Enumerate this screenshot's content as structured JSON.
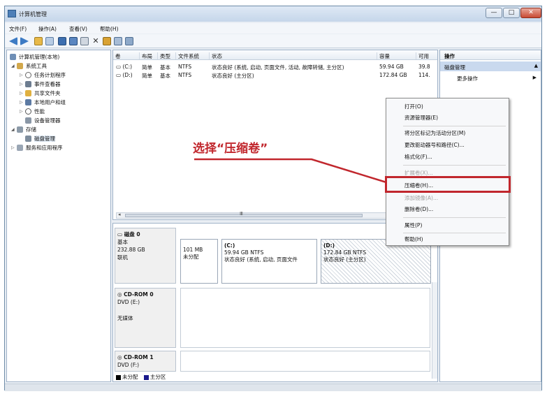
{
  "window": {
    "title": "计算机管理",
    "buttons": {
      "minimize": "—",
      "maximize": "□",
      "close": "✕"
    }
  },
  "menu": [
    "文件(F)",
    "操作(A)",
    "查看(V)",
    "帮助(H)"
  ],
  "toolbar": {
    "icons": [
      "back-icon",
      "forward-icon",
      "up-folder-icon",
      "console-tree-icon",
      "properties-icon",
      "help-icon",
      "delete-icon",
      "check-icon",
      "open-folder-icon",
      "search-icon",
      "zoom-icon"
    ]
  },
  "tree": {
    "items": [
      {
        "label": "计算机管理(本地)",
        "icon": "computer-icon",
        "expander": ""
      },
      {
        "label": "系统工具",
        "icon": "tools-icon",
        "expander": "◢"
      },
      {
        "label": "任务计划程序",
        "icon": "clock-icon",
        "expander": "▷"
      },
      {
        "label": "事件查看器",
        "icon": "event-viewer-icon",
        "expander": "▷"
      },
      {
        "label": "共享文件夹",
        "icon": "shared-folder-icon",
        "expander": "▷"
      },
      {
        "label": "本地用户和组",
        "icon": "users-icon",
        "expander": "▷"
      },
      {
        "label": "性能",
        "icon": "performance-icon",
        "expander": "▷"
      },
      {
        "label": "设备管理器",
        "icon": "device-manager-icon",
        "expander": ""
      },
      {
        "label": "存储",
        "icon": "storage-icon",
        "expander": "◢"
      },
      {
        "label": "磁盘管理",
        "icon": "disk-management-icon",
        "expander": ""
      },
      {
        "label": "服务和应用程序",
        "icon": "services-icon",
        "expander": "▷"
      }
    ]
  },
  "volumes": {
    "columns": [
      "卷",
      "布局",
      "类型",
      "文件系统",
      "状态",
      "容量",
      "可用"
    ],
    "rows": [
      [
        "(C:)",
        "简单",
        "基本",
        "NTFS",
        "状态良好 (系统, 启动, 页面文件, 活动, 故障转储, 主分区)",
        "59.94 GB",
        "39.8"
      ],
      [
        "(D:)",
        "简单",
        "基本",
        "NTFS",
        "状态良好 (主分区)",
        "172.84 GB",
        "114."
      ]
    ],
    "scroll_grip": "Ⅲ"
  },
  "disks": {
    "disk0": {
      "name": "磁盘 0",
      "type": "基本",
      "size": "232.88 GB",
      "status": "联机"
    },
    "partitions": [
      {
        "title": "",
        "line1": "101 MB",
        "line2": "未分配"
      },
      {
        "title": "(C:)",
        "line1": "59.94 GB NTFS",
        "line2": "状态良好 (系统, 启动, 页面文件"
      },
      {
        "title": "(D:)",
        "line1": "172.84 GB NTFS",
        "line2": "状态良好 (主分区)"
      }
    ],
    "cdrom0": {
      "name": "CD-ROM 0",
      "drive": "DVD (E:)",
      "media": "无媒体"
    },
    "cdrom1": {
      "name": "CD-ROM 1",
      "drive": "DVD (F:)"
    },
    "legend": [
      "未分配",
      "主分区"
    ],
    "colors": {
      "unallocated": "#000000",
      "primary": "#1a1a8c"
    }
  },
  "actions": {
    "header": "操作",
    "section": "磁盘管理",
    "more": "更多操作"
  },
  "context_menu": {
    "items": [
      "打开(O)",
      "资源管理器(E)",
      "将分区标记为活动分区(M)",
      "更改驱动器号和路径(C)...",
      "格式化(F)...",
      "扩展卷(X)...",
      "压缩卷(H)...",
      "添加镜像(A)...",
      "删除卷(D)...",
      "属性(P)",
      "帮助(H)"
    ],
    "highlighted": "压缩卷(H)...",
    "accent": "#c1272d"
  },
  "annotation": "选择“压缩卷”"
}
